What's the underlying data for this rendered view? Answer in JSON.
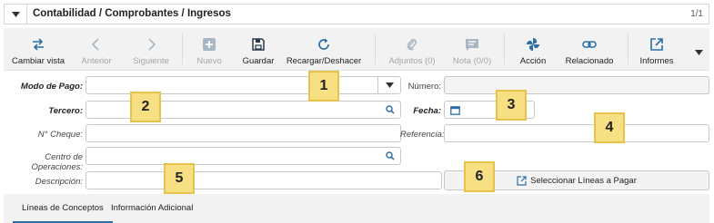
{
  "header": {
    "title": "Contabilidad / Comprobantes / Ingresos",
    "pager": "1/1"
  },
  "toolbar": {
    "buttons": [
      {
        "label": "Cambiar vista",
        "icon": "swap-arrows-icon",
        "enabled": true
      },
      {
        "label": "Anterior",
        "icon": "chevron-left-icon",
        "enabled": false
      },
      {
        "label": "Siguiente",
        "icon": "chevron-right-icon",
        "enabled": false
      },
      {
        "label": "Nuevo",
        "icon": "plus-square-icon",
        "enabled": false
      },
      {
        "label": "Guardar",
        "icon": "save-icon",
        "enabled": true
      },
      {
        "label": "Recargar/Deshacer",
        "icon": "refresh-icon",
        "enabled": true
      },
      {
        "label": "Adjuntos (0)",
        "icon": "paperclip-icon",
        "enabled": false
      },
      {
        "label": "Nota (0/0)",
        "icon": "note-icon",
        "enabled": false
      },
      {
        "label": "Acción",
        "icon": "fan-icon",
        "enabled": true
      },
      {
        "label": "Relacionado",
        "icon": "link-icon",
        "enabled": true
      },
      {
        "label": "Informes",
        "icon": "external-report-icon",
        "enabled": true
      }
    ],
    "more_icon": "caret-down-icon"
  },
  "form": {
    "modo_pago": {
      "label": "Modo de Pago:",
      "value": ""
    },
    "numero": {
      "label": "Número:",
      "value": ""
    },
    "tercero": {
      "label": "Tercero:",
      "value": ""
    },
    "fecha": {
      "label": "Fecha:",
      "value": ""
    },
    "cheque": {
      "label": "N° Cheque:",
      "value": ""
    },
    "referencia": {
      "label": "Referencia:",
      "value": ""
    },
    "centro": {
      "label": "Centro de Operaciones:",
      "value": ""
    },
    "descripcion": {
      "label": "Descripción:",
      "value": ""
    },
    "select_lines_button": "Seleccionar Líneas a Pagar"
  },
  "tabs": [
    {
      "label": "Líneas de Conceptos",
      "active": true
    },
    {
      "label": "Información Adicional",
      "active": false
    }
  ],
  "badges": [
    "1",
    "2",
    "3",
    "4",
    "5",
    "6"
  ],
  "colors": {
    "accent": "#2c6fa8",
    "badge_fill": "#f7df83",
    "badge_border": "#e6c34c",
    "disabled": "#a6a6a6"
  }
}
